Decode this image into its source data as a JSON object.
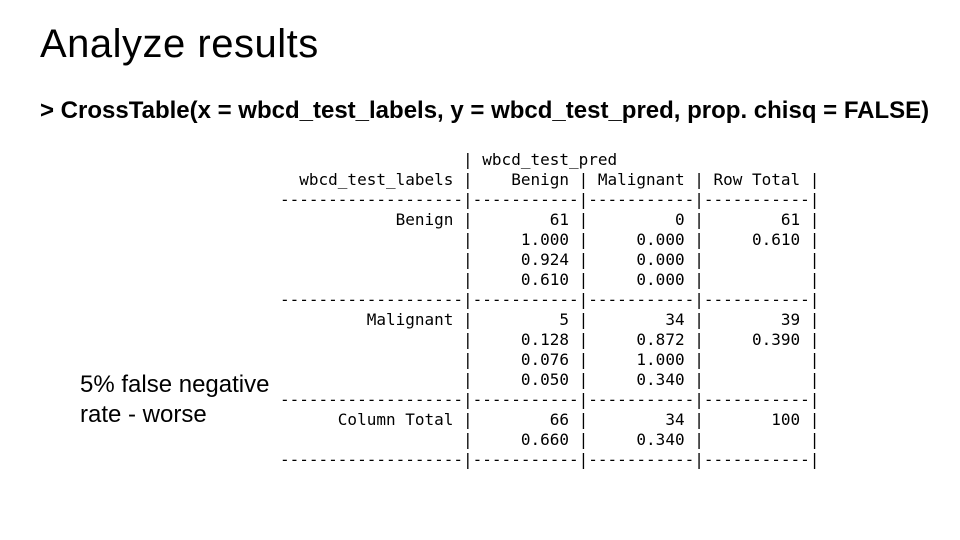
{
  "title": "Analyze results",
  "code_line": "> CrossTable(x = wbcd_test_labels, y = wbcd_test_pred, prop. chisq = FALSE)",
  "note": "5% false negative rate - worse",
  "table": {
    "header_top": "                   | wbcd_test_pred",
    "header_cols": "  wbcd_test_labels |    Benign | Malignant | Row Total |",
    "h_divider": "-------------------|-----------|-----------|-----------|",
    "benign": {
      "row1": "            Benign |        61 |         0 |        61 |",
      "row2": "                   |     1.000 |     0.000 |     0.610 |",
      "row3": "                   |     0.924 |     0.000 |           |",
      "row4": "                   |     0.610 |     0.000 |           |"
    },
    "malignant": {
      "row1": "         Malignant |         5 |        34 |        39 |",
      "row2": "                   |     0.128 |     0.872 |     0.390 |",
      "row3": "                   |     0.076 |     1.000 |           |",
      "row4": "                   |     0.050 |     0.340 |           |"
    },
    "total": {
      "row1": "      Column Total |        66 |        34 |       100 |",
      "row2": "                   |     0.660 |     0.340 |           |"
    }
  }
}
